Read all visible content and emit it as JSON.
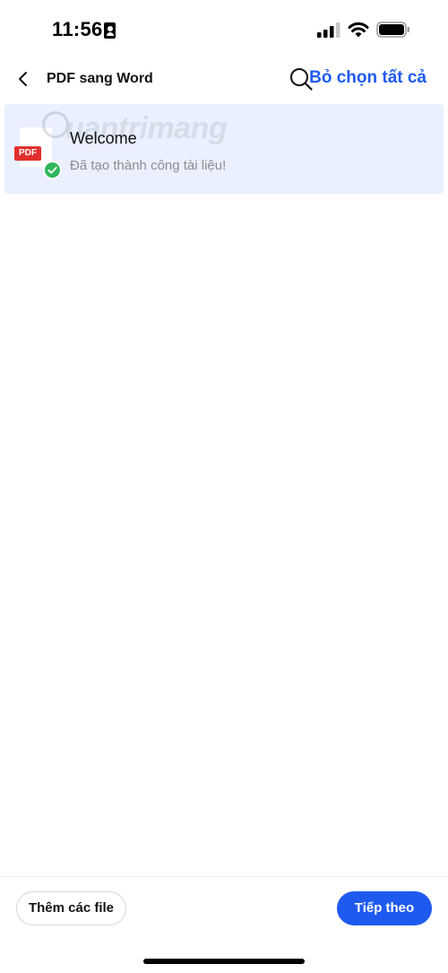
{
  "status_bar": {
    "time": "11:56",
    "icons": [
      "id-card-icon",
      "signal-icon",
      "wifi-icon",
      "battery-icon"
    ]
  },
  "nav": {
    "back_icon": "chevron-left-icon",
    "title": "PDF sang Word",
    "search_icon": "search-icon",
    "deselect_all_label": "Bỏ chọn tất cả"
  },
  "files": [
    {
      "name": "Welcome",
      "status": "Đã tạo thành công tài liệu!",
      "type_badge": "PDF",
      "selected": true
    }
  ],
  "watermark": {
    "text": "uantrimang"
  },
  "bottom": {
    "add_files_label": "Thêm các file",
    "next_label": "Tiếp theo"
  },
  "colors": {
    "accent": "#1f5af0",
    "selected_row": "#eaf0fd",
    "pdf_badge": "#e1302e",
    "success": "#2fb65a",
    "muted_text": "#8a8d93"
  }
}
